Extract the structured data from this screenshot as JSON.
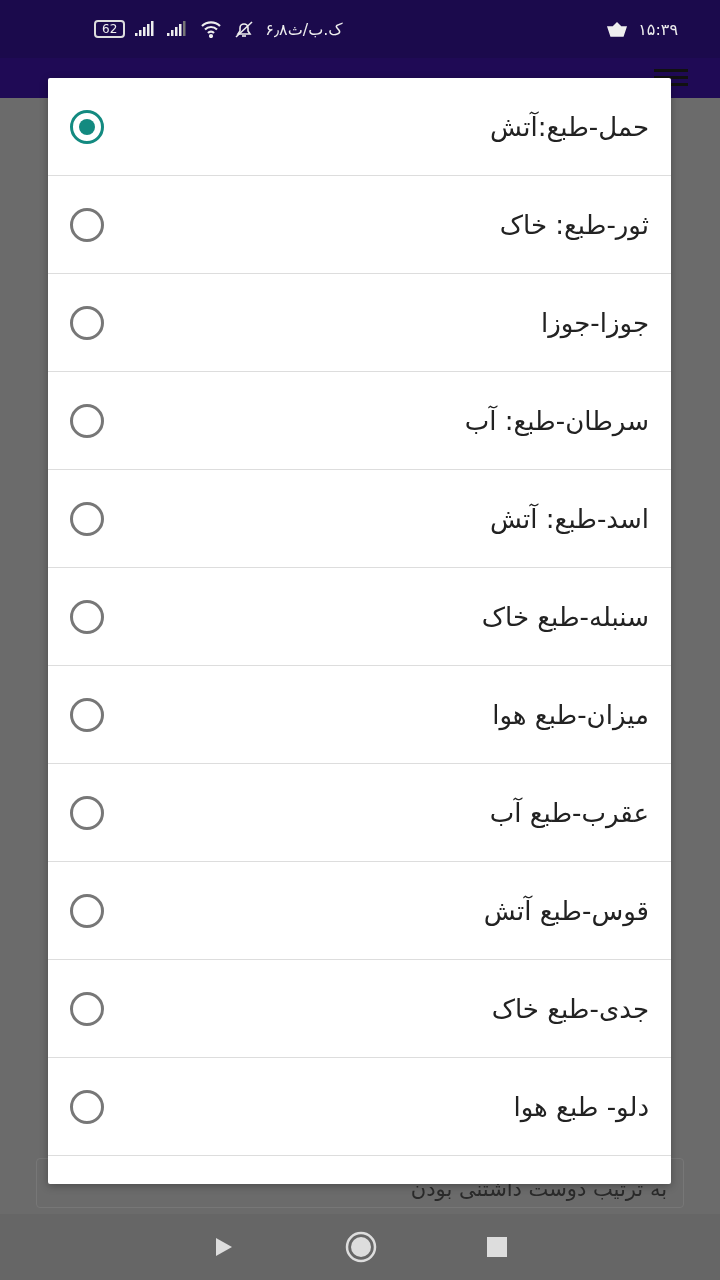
{
  "status_bar": {
    "time": "۱۵:۳۹",
    "network_speed": "۶٫۸ک.ب/ث",
    "battery": "62"
  },
  "background_field": {
    "value": "به ترتیب دوست داشتنی بودن"
  },
  "dialog": {
    "options": [
      {
        "label": "حمل-طبع:آتش",
        "selected": true
      },
      {
        "label": "ثور-طبع: خاک",
        "selected": false
      },
      {
        "label": "جوزا-جوزا",
        "selected": false
      },
      {
        "label": "سرطان-طبع: آب",
        "selected": false
      },
      {
        "label": "اسد-طبع: آتش",
        "selected": false
      },
      {
        "label": "سنبله-طبع خاک",
        "selected": false
      },
      {
        "label": "میزان-طبع هوا",
        "selected": false
      },
      {
        "label": "عقرب-طبع آب",
        "selected": false
      },
      {
        "label": "قوس-طبع آتش",
        "selected": false
      },
      {
        "label": "جدی-طبع خاک",
        "selected": false
      },
      {
        "label": "دلو- طبع هوا",
        "selected": false
      }
    ]
  }
}
